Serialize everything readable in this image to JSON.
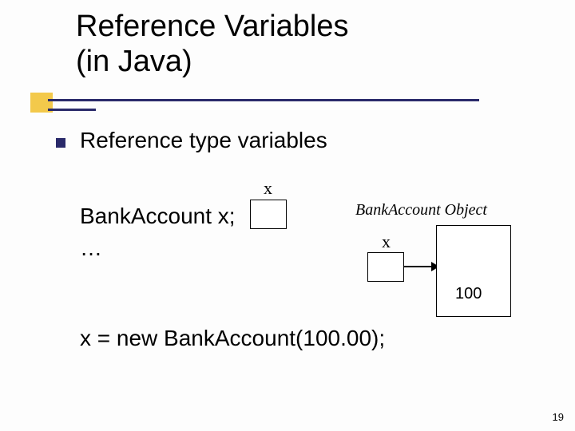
{
  "title": {
    "line1": "Reference Variables",
    "line2": "(in Java)"
  },
  "bullet": {
    "text": "Reference type variables"
  },
  "diagram": {
    "decl": "BankAccount x;",
    "dots": "…",
    "assign": "x = new BankAccount(100.00);",
    "x_label_1": "x",
    "x_label_2": "x",
    "object_caption": "BankAccount Object",
    "object_value": "100"
  },
  "page_number": "19"
}
